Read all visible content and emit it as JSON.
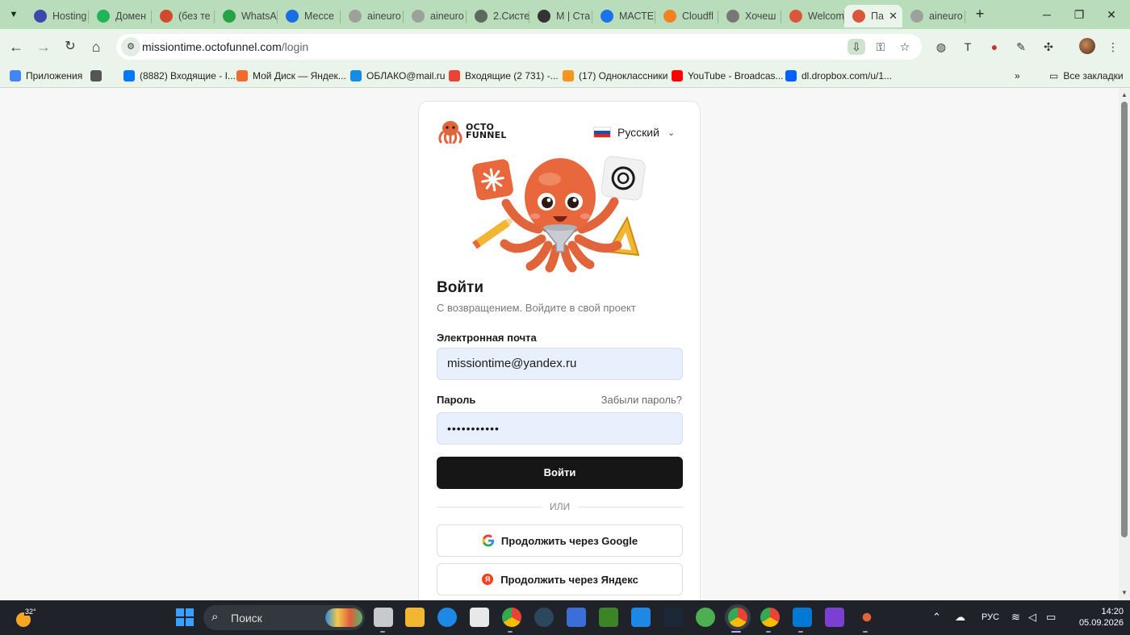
{
  "browser": {
    "tabs": [
      {
        "title": "Hosting",
        "color": "#3b4aa8"
      },
      {
        "title": "Домен",
        "color": "#20b35a"
      },
      {
        "title": "(без те",
        "color": "#d04a2c"
      },
      {
        "title": "WhatsA",
        "color": "#25a244"
      },
      {
        "title": "Мессе",
        "color": "#1a6fe0"
      },
      {
        "title": "aineuro",
        "color": "#9aa29a"
      },
      {
        "title": "aineuro",
        "color": "#9aa29a"
      },
      {
        "title": "2.Систе",
        "color": "#5b6b5b"
      },
      {
        "title": "M | Ста",
        "color": "#333333"
      },
      {
        "title": "МАСТЕ",
        "color": "#1a73e8"
      },
      {
        "title": "Cloudfl",
        "color": "#f48120"
      },
      {
        "title": "Хочеш",
        "color": "#777777"
      },
      {
        "title": "Welcom",
        "color": "#d9583b"
      },
      {
        "title": "Па",
        "color": "#d9583b",
        "active": true
      },
      {
        "title": "aineuro",
        "color": "#9aa29a"
      }
    ],
    "url_host": "missiontime.octofunnel.com",
    "url_path": "/login",
    "bookmarks": [
      {
        "label": "Приложения",
        "color": "#4285f4"
      },
      {
        "label": "",
        "color": "#555555"
      },
      {
        "label": "(8882) Входящие - I...",
        "color": "#0077ff"
      },
      {
        "label": "Мой Диск — Яндек...",
        "color": "#f26b2c"
      },
      {
        "label": "ОБЛАКО@mail.ru",
        "color": "#168de2"
      },
      {
        "label": "Входящие (2 731) -...",
        "color": "#ea4335"
      },
      {
        "label": "(17) Одноклассники",
        "color": "#f7931e"
      },
      {
        "label": "YouTube - Broadcas...",
        "color": "#ff0000"
      },
      {
        "label": "dl.dropbox.com/u/1...",
        "color": "#0061fe"
      }
    ],
    "all_bookmarks": "Все закладки"
  },
  "page": {
    "logo_line1": "OCTO",
    "logo_line2": "FUNNEL",
    "language": "Русский",
    "title": "Войти",
    "subtitle": "С возвращением. Войдите в свой проект",
    "email_label": "Электронная почта",
    "email_value": "missiontime@yandex.ru",
    "password_label": "Пароль",
    "forgot_link": "Забыли пароль?",
    "password_value": "•••••••••••",
    "submit_label": "Войти",
    "divider_text": "ИЛИ",
    "google_button": "Продолжить через Google",
    "yandex_button": "Продолжить через Яндекс",
    "accent_color": "#e2643a"
  },
  "taskbar": {
    "weather_temp": "32°",
    "search_placeholder": "Поиск",
    "language": "РУС",
    "time": "14:20",
    "date": "05.09.2026"
  }
}
